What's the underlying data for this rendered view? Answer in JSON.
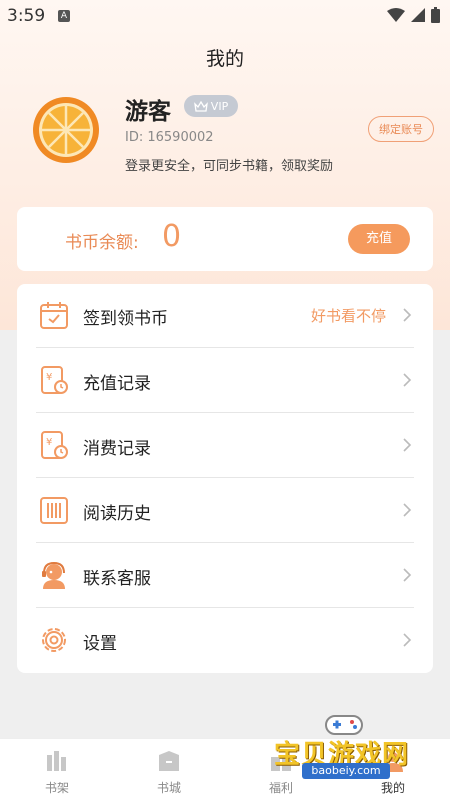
{
  "status_bar": {
    "time": "3:59",
    "notification_badge": "A"
  },
  "header": {
    "title": "我的"
  },
  "profile": {
    "username": "游客",
    "vip_label": "VIP",
    "id_text": "ID: 16590002",
    "login_tip": "登录更安全，可同步书籍，领取奖励",
    "bind_button": "绑定账号"
  },
  "balance": {
    "label": "书币余额:",
    "value": "0",
    "recharge_button": "充值"
  },
  "menu": [
    {
      "label": "签到领书币",
      "extra": "好书看不停",
      "icon": "calendar-icon"
    },
    {
      "label": "充值记录",
      "extra": "",
      "icon": "recharge-record-icon"
    },
    {
      "label": "消费记录",
      "extra": "",
      "icon": "consume-record-icon"
    },
    {
      "label": "阅读历史",
      "extra": "",
      "icon": "book-history-icon"
    },
    {
      "label": "联系客服",
      "extra": "",
      "icon": "customer-service-icon"
    },
    {
      "label": "设置",
      "extra": "",
      "icon": "gear-icon"
    }
  ],
  "tabs": [
    {
      "label": "书架",
      "icon": "bookshelf-icon"
    },
    {
      "label": "书城",
      "icon": "bookstore-icon"
    },
    {
      "label": "福利",
      "icon": "gift-icon"
    },
    {
      "label": "我的",
      "icon": "profile-icon"
    }
  ],
  "watermark": {
    "title": "宝贝游戏网",
    "url": "baobeiy.com"
  },
  "colors": {
    "accent": "#f29a63",
    "accent_dark": "#e98a55",
    "vip_badge": "#c5cad3"
  }
}
